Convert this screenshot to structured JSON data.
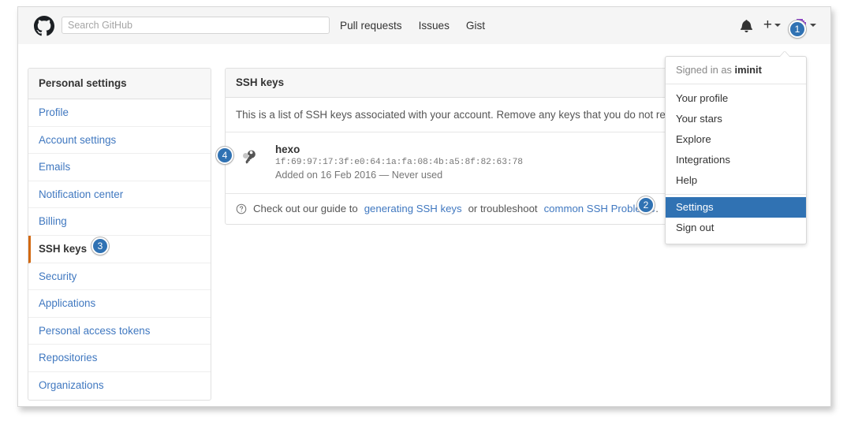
{
  "header": {
    "logo_icon": "github-mark-icon",
    "search": {
      "placeholder": "Search GitHub",
      "value": ""
    },
    "nav_links": [
      {
        "label": "Pull requests"
      },
      {
        "label": "Issues"
      },
      {
        "label": "Gist"
      }
    ],
    "notifications_icon": "bell-icon",
    "create_new": {
      "icon": "plus-icon",
      "caret": "chevron-down-icon"
    },
    "account": {
      "avatar_icon": "user-avatar-identicon",
      "caret": "chevron-down-icon"
    }
  },
  "sidebar": {
    "title": "Personal settings",
    "items": [
      {
        "label": "Profile",
        "active": false
      },
      {
        "label": "Account settings",
        "active": false
      },
      {
        "label": "Emails",
        "active": false
      },
      {
        "label": "Notification center",
        "active": false
      },
      {
        "label": "Billing",
        "active": false
      },
      {
        "label": "SSH keys",
        "active": true
      },
      {
        "label": "Security",
        "active": false
      },
      {
        "label": "Applications",
        "active": false
      },
      {
        "label": "Personal access tokens",
        "active": false
      },
      {
        "label": "Repositories",
        "active": false
      },
      {
        "label": "Organizations",
        "active": false
      }
    ]
  },
  "main": {
    "panel_title": "SSH keys",
    "description": "This is a list of SSH keys associated with your account. Remove any keys that you do not recognize.",
    "key": {
      "icon": "key-icon",
      "title": "hexo",
      "fingerprint": "1f:69:97:17:3f:e0:64:1a:fa:08:4b:a5:8f:82:63:78",
      "meta": "Added on 16 Feb 2016 — Never used"
    },
    "footer": {
      "icon": "question-circle-icon",
      "text_before": "Check out our guide to",
      "link1": "generating SSH keys",
      "text_middle": "or troubleshoot",
      "link2": "common SSH Problems",
      "text_after": "."
    }
  },
  "dropdown": {
    "signed_in_prefix": "Signed in as",
    "username": "iminit",
    "group1": [
      {
        "label": "Your profile"
      },
      {
        "label": "Your stars"
      },
      {
        "label": "Explore"
      },
      {
        "label": "Integrations"
      },
      {
        "label": "Help"
      }
    ],
    "group2": [
      {
        "label": "Settings",
        "selected": true
      },
      {
        "label": "Sign out",
        "selected": false
      }
    ]
  },
  "annotations": {
    "badges": [
      {
        "number": "1"
      },
      {
        "number": "2"
      },
      {
        "number": "3"
      },
      {
        "number": "4"
      }
    ]
  },
  "colors": {
    "accent_blue": "#4078c0",
    "selected_blue": "#3072b3",
    "active_orange": "#d26911",
    "avatar_purple": "#a24fd6"
  }
}
